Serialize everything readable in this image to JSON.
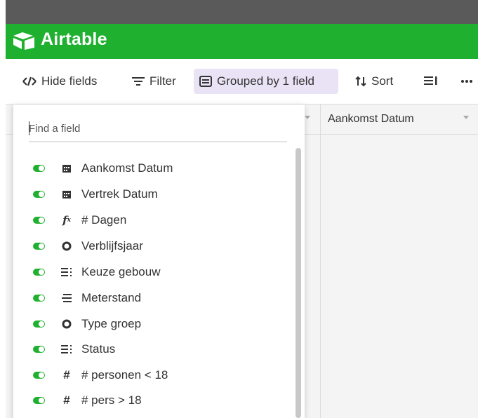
{
  "app": {
    "name": "Airtable",
    "brand_color": "#20b030",
    "accent_active": "#e9e3f5"
  },
  "toolbar": {
    "hide_fields": {
      "label": "Hide fields",
      "icon": "eye-slash-icon"
    },
    "filter": {
      "label": "Filter",
      "icon": "filter-icon"
    },
    "group": {
      "label": "Grouped by 1 field",
      "icon": "group-icon",
      "active": true
    },
    "sort": {
      "label": "Sort",
      "icon": "sort-icon"
    },
    "row_height_icon": "row-height-icon",
    "more_icon": "ellipsis-icon"
  },
  "grid": {
    "columns": [
      {
        "label": ""
      },
      {
        "label": "Aankomst Datum"
      }
    ]
  },
  "field_panel": {
    "search_placeholder": "Find a field",
    "fields": [
      {
        "label": "Aankomst Datum",
        "icon": "calendar-icon",
        "visible": true
      },
      {
        "label": "Vertrek Datum",
        "icon": "calendar-icon",
        "visible": true
      },
      {
        "label": "# Dagen",
        "icon": "formula-icon",
        "visible": true
      },
      {
        "label": "Verblijfsjaar",
        "icon": "single-select-icon",
        "visible": true
      },
      {
        "label": "Keuze gebouw",
        "icon": "multi-select-icon",
        "visible": true
      },
      {
        "label": "Meterstand",
        "icon": "long-text-icon",
        "visible": true
      },
      {
        "label": "Type groep",
        "icon": "single-select-icon",
        "visible": true
      },
      {
        "label": "Status",
        "icon": "multi-select-icon",
        "visible": true
      },
      {
        "label": "# personen < 18",
        "icon": "number-icon",
        "visible": true
      },
      {
        "label": "# pers > 18",
        "icon": "number-icon",
        "visible": true
      }
    ]
  }
}
